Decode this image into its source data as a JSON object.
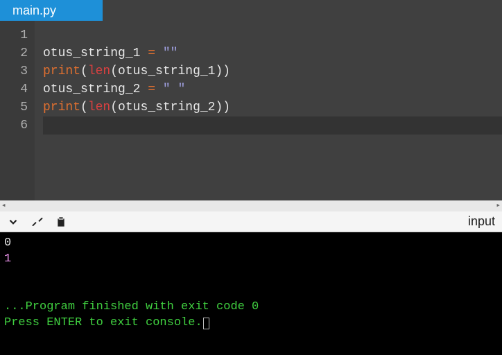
{
  "tab": {
    "label": "main.py"
  },
  "editor": {
    "line_numbers": [
      "1",
      "2",
      "3",
      "4",
      "5",
      "6"
    ],
    "lines": [
      [],
      [
        {
          "cls": "tk-id",
          "t": "otus_string_1"
        },
        {
          "cls": "tk-id",
          "t": " "
        },
        {
          "cls": "tk-op",
          "t": "="
        },
        {
          "cls": "tk-id",
          "t": " "
        },
        {
          "cls": "tk-str",
          "t": "\"\""
        }
      ],
      [
        {
          "cls": "tk-fn",
          "t": "print"
        },
        {
          "cls": "tk-punc",
          "t": "("
        },
        {
          "cls": "tk-bi",
          "t": "len"
        },
        {
          "cls": "tk-punc",
          "t": "("
        },
        {
          "cls": "tk-id",
          "t": "otus_string_1"
        },
        {
          "cls": "tk-punc",
          "t": "))"
        }
      ],
      [
        {
          "cls": "tk-id",
          "t": "otus_string_2"
        },
        {
          "cls": "tk-id",
          "t": " "
        },
        {
          "cls": "tk-op",
          "t": "="
        },
        {
          "cls": "tk-id",
          "t": " "
        },
        {
          "cls": "tk-str",
          "t": "\" \""
        }
      ],
      [
        {
          "cls": "tk-fn",
          "t": "print"
        },
        {
          "cls": "tk-punc",
          "t": "("
        },
        {
          "cls": "tk-bi",
          "t": "len"
        },
        {
          "cls": "tk-punc",
          "t": "("
        },
        {
          "cls": "tk-id",
          "t": "otus_string_2"
        },
        {
          "cls": "tk-punc",
          "t": "))"
        }
      ],
      []
    ],
    "current_line_index": 5
  },
  "toolbar": {
    "input_label": "input"
  },
  "console": {
    "out0": "0",
    "out1": "1",
    "finished": "...Program finished with exit code 0",
    "prompt": "Press ENTER to exit console."
  }
}
